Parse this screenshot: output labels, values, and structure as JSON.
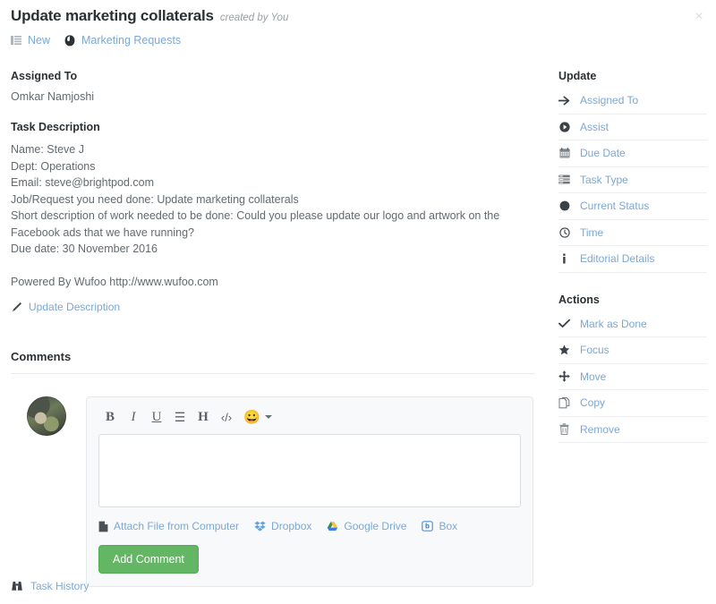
{
  "header": {
    "title": "Update marketing collaterals",
    "created_by": "created by You",
    "close_label": "×",
    "breadcrumb": [
      {
        "icon": "list-icon",
        "label": "New"
      },
      {
        "icon": "pod-icon",
        "label": "Marketing Requests"
      }
    ]
  },
  "main": {
    "assigned_to_heading": "Assigned To",
    "assignee": "Omkar Namjoshi",
    "task_description_heading": "Task Description",
    "description_lines": [
      "Name: Steve J",
      "Dept: Operations",
      "Email: steve@brightpod.com",
      "Job/Request you need done: Update marketing collaterals",
      "Short description of work needed to be done: Could you please update our logo and artwork on the Facebook ads that we have running?",
      "Due date: 30 November 2016"
    ],
    "powered_by": "Powered By Wufoo http://www.wufoo.com",
    "update_description_label": "Update Description"
  },
  "comments": {
    "heading": "Comments",
    "toolbar": [
      {
        "name": "bold-icon",
        "glyph": "B"
      },
      {
        "name": "italic-icon",
        "glyph": "I"
      },
      {
        "name": "underline-icon",
        "glyph": "U"
      },
      {
        "name": "bullet-list-icon",
        "glyph": "☰"
      },
      {
        "name": "heading-icon",
        "glyph": "H"
      },
      {
        "name": "code-icon",
        "glyph": "‹/›"
      }
    ],
    "emoji_glyph": "😀",
    "comment_placeholder": "",
    "comment_value": "",
    "attachments": [
      {
        "icon": "file-icon",
        "label": "Attach File from Computer"
      },
      {
        "icon": "dropbox-icon",
        "label": "Dropbox"
      },
      {
        "icon": "google-drive-icon",
        "label": "Google Drive"
      },
      {
        "icon": "box-icon",
        "label": "Box"
      }
    ],
    "add_comment_label": "Add Comment"
  },
  "task_history": {
    "label": "Task History",
    "icon": "binoculars-icon"
  },
  "sidebar": {
    "update_heading": "Update",
    "update_items": [
      {
        "icon": "arrow-right-icon",
        "label": "Assigned To"
      },
      {
        "icon": "assist-circle-icon",
        "label": "Assist"
      },
      {
        "icon": "calendar-icon",
        "label": "Due Date"
      },
      {
        "icon": "task-type-icon",
        "label": "Task Type"
      },
      {
        "icon": "status-circle-icon",
        "label": "Current Status"
      },
      {
        "icon": "clock-icon",
        "label": "Time"
      },
      {
        "icon": "info-icon",
        "label": "Editorial Details"
      }
    ],
    "actions_heading": "Actions",
    "action_items": [
      {
        "icon": "check-icon",
        "label": "Mark as Done"
      },
      {
        "icon": "star-icon",
        "label": "Focus"
      },
      {
        "icon": "move-icon",
        "label": "Move"
      },
      {
        "icon": "copy-icon",
        "label": "Copy"
      },
      {
        "icon": "trash-icon",
        "label": "Remove"
      }
    ]
  },
  "colors": {
    "link": "#7ba7d7",
    "text": "#636a70",
    "heading": "#2b3034",
    "button_green": "#63b664",
    "divider": "#eceef0"
  }
}
